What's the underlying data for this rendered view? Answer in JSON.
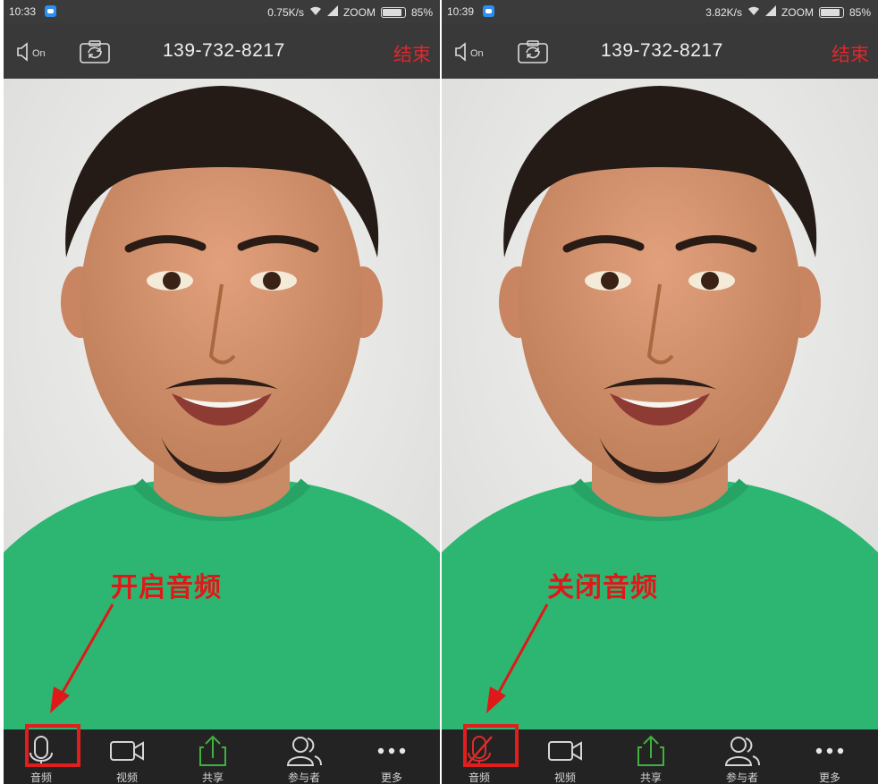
{
  "left": {
    "status": {
      "time": "10:33",
      "speed": "0.75K/s",
      "carrier": "ZOOM",
      "battery": "85%"
    },
    "topbar": {
      "speaker_label": "On",
      "number": "139-732-8217",
      "end_label": "结束"
    },
    "toolbar": {
      "audio": "音频",
      "video": "视频",
      "share": "共享",
      "participants": "参与者",
      "more": "更多"
    },
    "callout": "开启音频",
    "audio_state": "on"
  },
  "right": {
    "status": {
      "time": "10:39",
      "speed": "3.82K/s",
      "carrier": "ZOOM",
      "battery": "85%"
    },
    "topbar": {
      "speaker_label": "On",
      "number": "139-732-8217",
      "end_label": "结束"
    },
    "toolbar": {
      "audio": "音频",
      "video": "视频",
      "share": "共享",
      "participants": "参与者",
      "more": "更多"
    },
    "callout": "关闭音频",
    "audio_state": "muted"
  },
  "colors": {
    "annotation": "#e01818",
    "end": "#e0262c",
    "share": "#3fb13f",
    "shirt": "#2db672"
  }
}
